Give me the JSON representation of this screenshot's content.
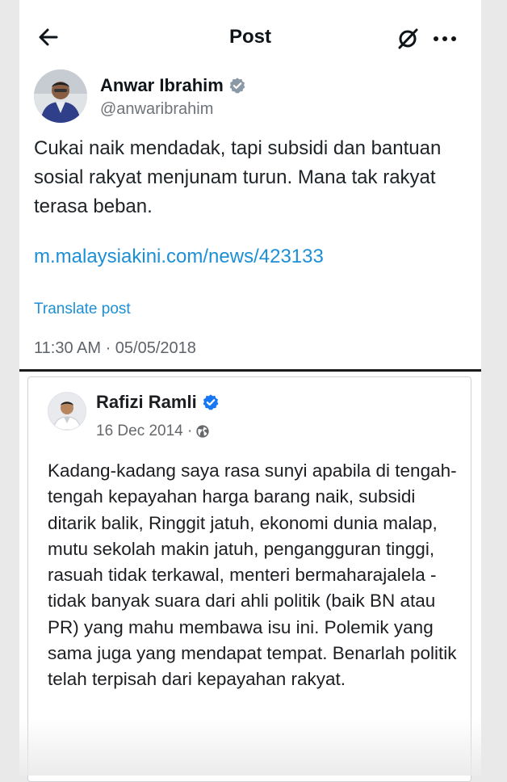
{
  "header": {
    "title": "Post",
    "back_icon": "arrow-left-icon",
    "grok_icon": "grok-icon",
    "more_icon": "more-horizontal-icon"
  },
  "post": {
    "author_name": "Anwar Ibrahim",
    "author_handle": "@anwaribrahim",
    "verified_color": "#8b98a5",
    "text": "Cukai naik mendadak, tapi subsidi dan bantuan sosial rakyat menjunam turun. Mana tak rakyat terasa beban.",
    "link": "m.malaysiakini.com/news/423133",
    "translate_label": "Translate post",
    "timestamp": "11:30 AM · 05/05/2018"
  },
  "quoted": {
    "author_name": "Rafizi Ramli",
    "date": "16 Dec 2014 ·",
    "privacy_icon": "globe-icon",
    "verified_color": "#1877f2",
    "text": "Kadang-kadang saya rasa sunyi apabila di tengah-tengah kepayahan harga barang naik, subsidi ditarik balik, Ringgit jatuh, ekonomi dunia malap, mutu sekolah makin jatuh, pengangguran tinggi, rasuah tidak terkawal, menteri bermaharajalela - tidak banyak suara dari ahli politik (baik BN atau PR) yang mahu membawa isu ini. Polemik yang sama juga yang mendapat tempat. Benarlah politik telah terpisah dari kepayahan rakyat."
  }
}
